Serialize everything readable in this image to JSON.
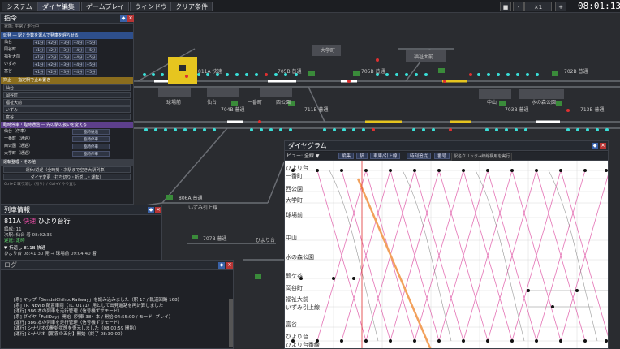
{
  "menu": {
    "system": "システム",
    "dia_edit": "ダイヤ編集",
    "gameplay": "ゲームプレイ",
    "window": "ウィンドウ",
    "clear_cond": "クリア条件"
  },
  "speed": "×1",
  "clock": "08:01:13",
  "command_panel": {
    "title": "指令",
    "status": "状態: 平常 / 走行中",
    "sec1": "延発 ― 駅と分数を選んで発車を遅らせる",
    "delay_rows": [
      {
        "station": "仙台",
        "btns": [
          "+1分",
          "+2分",
          "+3分",
          "+4分",
          "+5分"
        ]
      },
      {
        "station": "岡谷町",
        "btns": [
          "+1分",
          "+2分",
          "+3分",
          "+4分",
          "+5分"
        ]
      },
      {
        "station": "福祉大前",
        "btns": [
          "+1分",
          "+2分",
          "+3分",
          "+4分",
          "+5分"
        ]
      },
      {
        "station": "いずみ",
        "btns": [
          "+1分",
          "+2分",
          "+3分",
          "+4分",
          "+5分"
        ]
      },
      {
        "station": "富谷",
        "btns": [
          "+1分",
          "+2分",
          "+3分",
          "+4分",
          "+5分"
        ]
      }
    ],
    "sec2": "抑止 ― 指定駅で止め置き",
    "hold_rows": [
      "仙台",
      "岡谷町",
      "福祉大前",
      "いずみ",
      "富谷"
    ],
    "sec3": "臨時停車・臨時通過 ― 先の駅の扱いを変える",
    "special_rows": [
      {
        "label": "仙台（停車）",
        "btn": "臨時通過"
      },
      {
        "label": "一番町（通過）",
        "btn": "臨時停車"
      },
      {
        "label": "西公園（通過）",
        "btn": "臨時停車"
      },
      {
        "label": "大学町（通過）",
        "btn": "臨時停車"
      }
    ],
    "sec4": "運転整理・その他",
    "btn_a": "運休/返遅（全時刻・次駅まで空き大駅列車）",
    "btn_b": "ダイヤ変更（打ち切り・折返し・運転）",
    "footer": "Ctrl+Z 取り消し（有り）/ Ctrl+Y やり直し"
  },
  "train_panel": {
    "title": "列車情報",
    "number": "811A",
    "kind": "快速",
    "dest": "ひより台行",
    "formation": "編成: 11",
    "next": "次駅: 仙台 着 08:02:35",
    "delay": "遅延: 定時",
    "return_head": "▼ 折返し 811B 快速",
    "return_line": "ひより台 08:41:30 発 → 球場前 09:04:40 着"
  },
  "log_panel": {
    "title": "ログ",
    "lines": [
      "[系] マップ「SendaiChihouRailway」を読み込みました（駅 17 / 軌道回路 168）",
      "[系] TR_NEW8 配置車両（TC_0171）用として出発進路を再計算しました",
      "[運行] 386 本の列車を走行管理（信号機ずサモード）",
      "[系] ダイヤ「FullDay」開始（列車 384 本 / 開始 04:55:00 / モード: プレイ）",
      "[運行] 386 本の列車を走行管理（信号機ずサモード）",
      "[運行] シナリオの開始状態を復元しました（08:00:59 開始）",
      "[運行] シナリオ【朝霧の五分】開始（終了 08:30:00）"
    ]
  },
  "diagram": {
    "title": "ダイヤグラム",
    "view": "ビュー: 全線 ▼",
    "btns": [
      "編集",
      "駅",
      "車庫/引上線",
      "時刻追従",
      "番号"
    ],
    "hint": "駅名クリック→線線構用を実行",
    "stations": [
      "ひより台",
      "一番町",
      "西公園",
      "大学町",
      "球場前",
      "中山",
      "水の森公園",
      "鶴ケ谷",
      "岡谷町",
      "福祉大前",
      "いずみ引上線",
      "富谷",
      "ひより台",
      "ひより台番線"
    ]
  },
  "map_labels": {
    "trains": [
      "811A 快速",
      "705B 普通",
      "705B 普通",
      "702B 普通",
      "704B 普通",
      "711B 普通",
      "703B 普通",
      "713B 普通",
      "806A 普通",
      "707B 普通"
    ],
    "stations": [
      "仙台",
      "一番町",
      "西公園",
      "大学町",
      "中山",
      "水の森公園",
      "福祉大前",
      "球場前",
      "いずみ引上線",
      "ひより台"
    ]
  },
  "colors": {
    "accent": "#3a62a8",
    "rapid": "#e04aa0",
    "ok": "#5ecf6a",
    "signal_green": "#39e0d8",
    "signal_red": "#e03030"
  }
}
